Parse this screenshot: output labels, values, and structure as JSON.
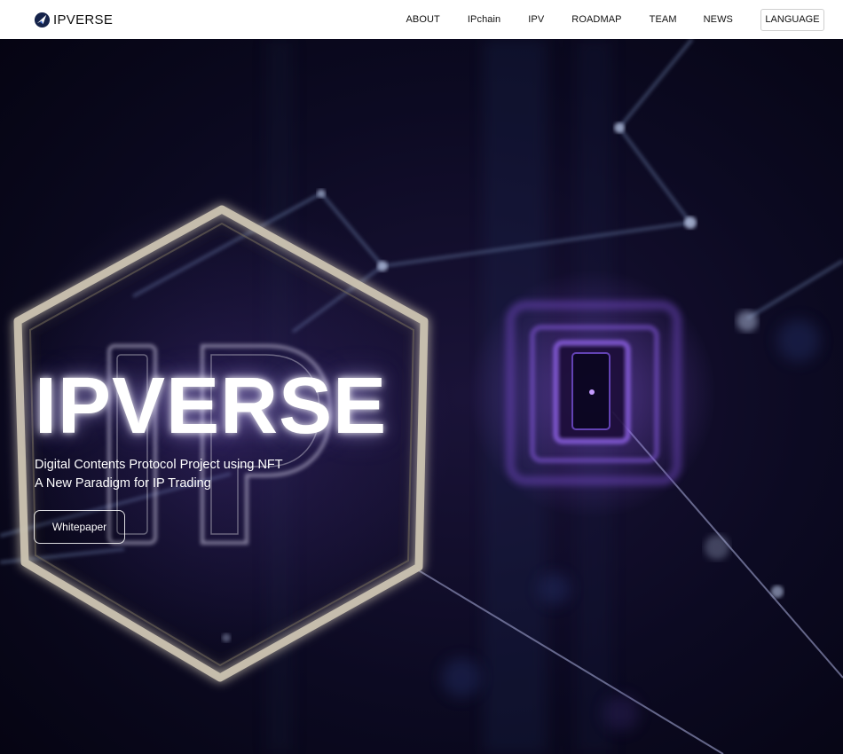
{
  "brand": {
    "name": "IPVERSE",
    "logo_icon": "compass-arrow-icon"
  },
  "nav": {
    "items": [
      {
        "label": "ABOUT"
      },
      {
        "label": "IPchain"
      },
      {
        "label": "IPV"
      },
      {
        "label": "ROADMAP"
      },
      {
        "label": "TEAM"
      },
      {
        "label": "NEWS"
      }
    ],
    "language_label": "LANGUAGE"
  },
  "hero": {
    "title": "IPVERSE",
    "subtitle_line1": "Digital Contents Protocol Project using NFT",
    "subtitle_line2": "A New Paradigm for IP Trading",
    "cta_label": "Whitepaper",
    "background_letters": "IP"
  },
  "colors": {
    "header_bg": "#ffffff",
    "hero_bg": "#07061a",
    "accent_purple": "#7b4dd6",
    "hexagon_frame": "#c9bfae"
  }
}
